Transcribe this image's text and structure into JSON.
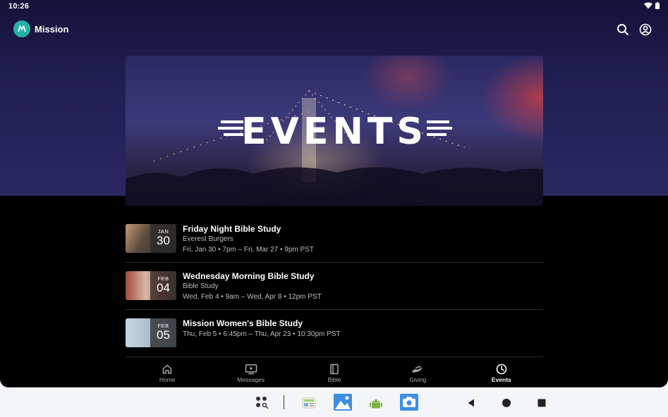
{
  "status": {
    "time": "10:26"
  },
  "app": {
    "title": "Mission"
  },
  "banner": {
    "text": "EVENTS"
  },
  "events": [
    {
      "title": "Friday Night Bible Study",
      "subtitle": "Everest Burgers",
      "time": "Fri, Jan 30 • 7pm – Fri, Mar 27 • 9pm PST",
      "month": "JAN",
      "day": "30"
    },
    {
      "title": "Wednesday Morning Bible Study",
      "subtitle": "Bible Study",
      "time": "Wed, Feb 4 • 9am – Wed, Apr 8 • 12pm PST",
      "month": "FEB",
      "day": "04"
    },
    {
      "title": "Mission Women's Bible Study",
      "subtitle": "",
      "time": "Thu, Feb 5 • 6:45pm – Thu, Apr 23 • 10:30pm PST",
      "month": "FEB",
      "day": "05"
    }
  ],
  "nav": [
    {
      "label": "Home",
      "icon": "home-icon"
    },
    {
      "label": "Messages",
      "icon": "play-screen-icon"
    },
    {
      "label": "Bible",
      "icon": "book-icon"
    },
    {
      "label": "Giving",
      "icon": "hand-icon"
    },
    {
      "label": "Events",
      "icon": "clock-icon",
      "active": true
    }
  ],
  "colors": {
    "accent": "#22b3a6",
    "header_bg": "#221f55",
    "active_nav": "#ffffff",
    "inactive_nav": "#a9a9a9"
  }
}
